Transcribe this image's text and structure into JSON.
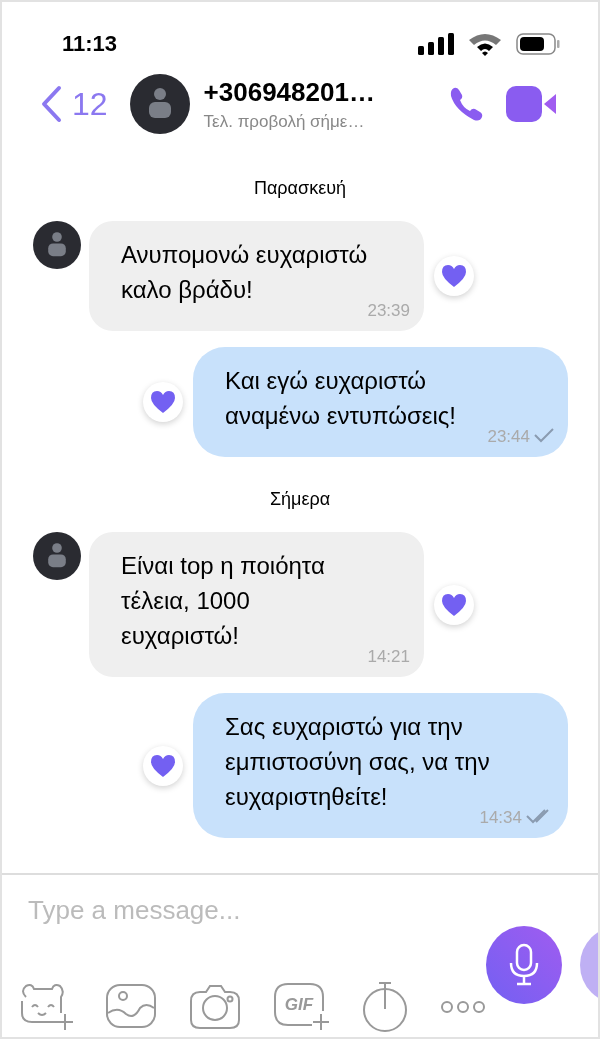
{
  "status_bar": {
    "time": "11:13"
  },
  "header": {
    "back_count": "12",
    "contact_name": "+306948201…",
    "last_seen": "Τελ. προβολή σήμε…"
  },
  "messages": [
    {
      "kind": "date",
      "text": "Παρασκευή"
    },
    {
      "kind": "incoming",
      "text": "Ανυπομονώ ευχαριστώ καλο βράδυ!",
      "time": "23:39",
      "liked": true
    },
    {
      "kind": "outgoing",
      "text": "Και εγώ ευχαριστώ αναμένω εντυπώσεις!",
      "time": "23:44",
      "liked": true,
      "read": false
    },
    {
      "kind": "date",
      "text": "Σήμερα"
    },
    {
      "kind": "incoming",
      "text": "Είναι top η ποιόητα τέλεια, 1000 ευχαριστώ!",
      "time": "14:21",
      "liked": true
    },
    {
      "kind": "outgoing",
      "text": "Σας ευχαριστώ για την εμπιστοσύνη σας, να την ευχαριστηθείτε!",
      "time": "14:34",
      "liked": true,
      "read": true
    }
  ],
  "composer": {
    "placeholder": "Type a message...",
    "gif_label": "GIF"
  }
}
